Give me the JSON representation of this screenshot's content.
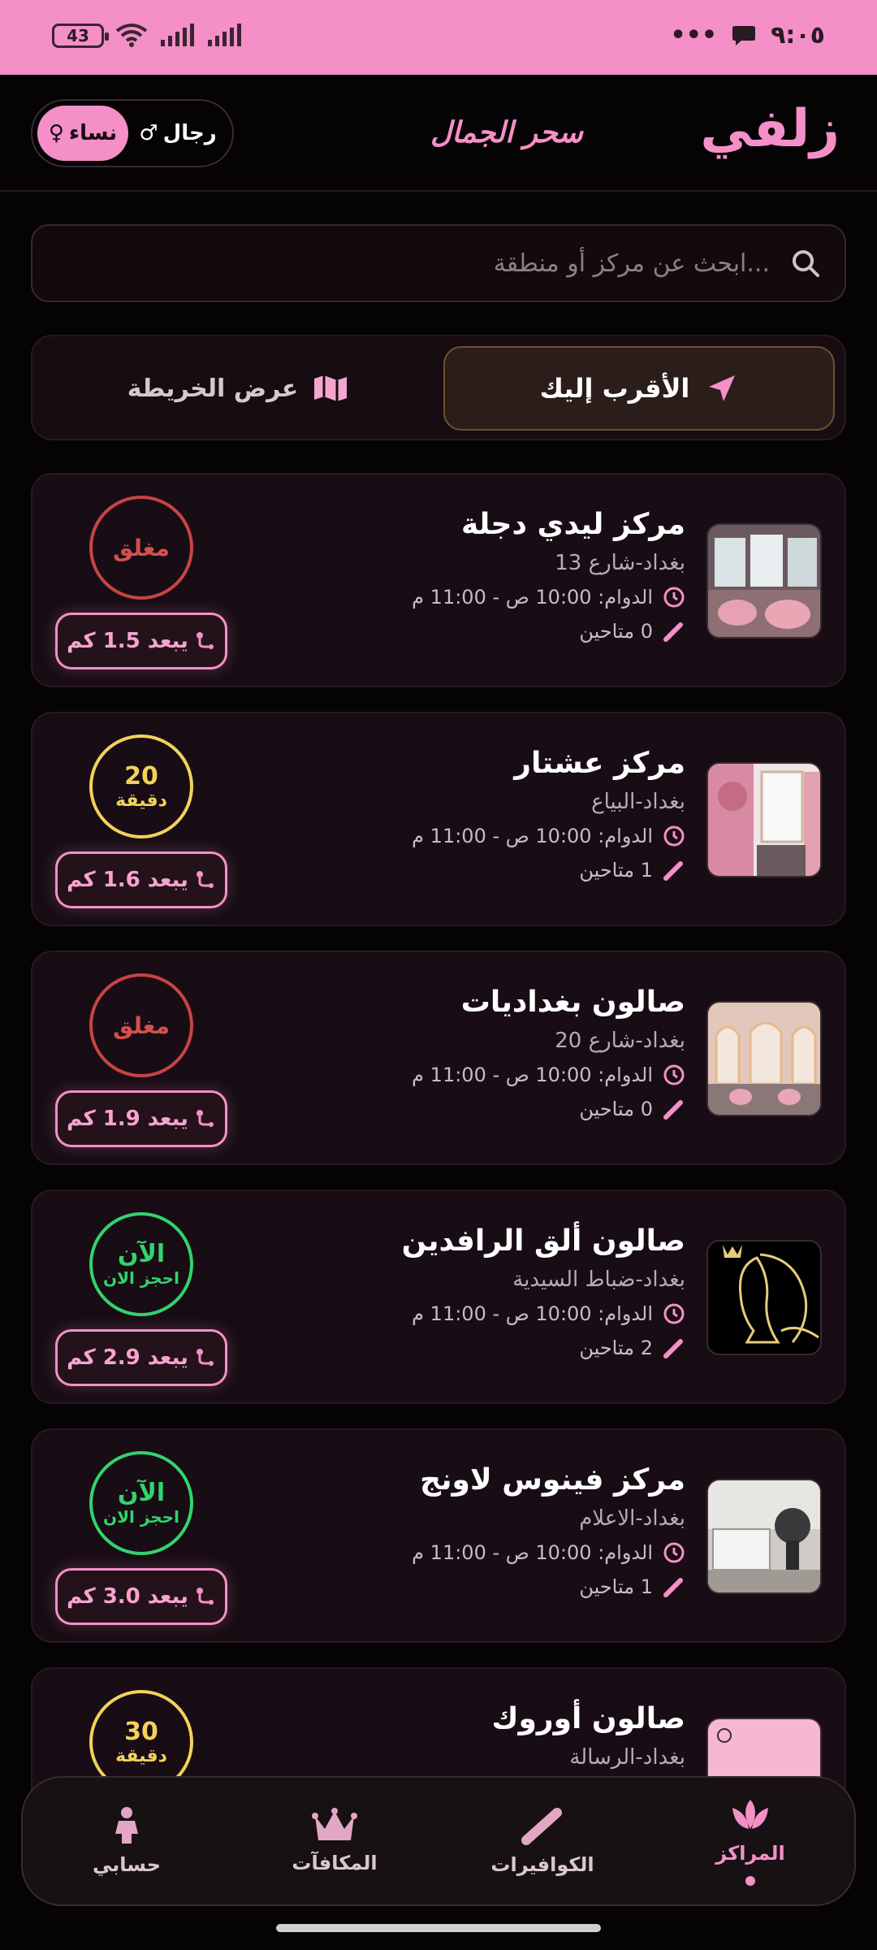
{
  "status_bar": {
    "battery": "43",
    "time": "٩:٠٥",
    "more": "•••"
  },
  "header": {
    "app_title": "زلفي",
    "logo_text": "سحر الجمال",
    "gender_women": "نساء",
    "gender_men": "رجال"
  },
  "search": {
    "placeholder": "ابحث عن مركز أو منطقة..."
  },
  "toggle": {
    "nearest": "الأقرب إليك",
    "map": "عرض الخريطة"
  },
  "centers": [
    {
      "name": "مركز ليدي دجلة",
      "area": "بغداد-شارع 13",
      "hours": "الدوام: 10:00 ص - 11:00 م",
      "stylists": "0 متاحين",
      "status": "closed",
      "status_main": "مغلق",
      "status_sub": "",
      "distance": "يبعد 1.5 كم"
    },
    {
      "name": "مركز عشتار",
      "area": "بغداد-البياع",
      "hours": "الدوام: 10:00 ص - 11:00 م",
      "stylists": "1 متاحين",
      "status": "wait",
      "status_main": "20",
      "status_sub": "دقيقة",
      "distance": "يبعد 1.6 كم"
    },
    {
      "name": "صالون بغداديات",
      "area": "بغداد-شارع 20",
      "hours": "الدوام: 10:00 ص - 11:00 م",
      "stylists": "0 متاحين",
      "status": "closed",
      "status_main": "مغلق",
      "status_sub": "",
      "distance": "يبعد 1.9 كم"
    },
    {
      "name": "صالون ألق الرافدين",
      "area": "بغداد-ضباط السيدية",
      "hours": "الدوام: 10:00 ص - 11:00 م",
      "stylists": "2 متاحين",
      "status": "open",
      "status_main": "الآن",
      "status_sub": "احجز الان",
      "distance": "يبعد 2.9 كم"
    },
    {
      "name": "مركز فينوس لاونج",
      "area": "بغداد-الاعلام",
      "hours": "الدوام: 10:00 ص - 11:00 م",
      "stylists": "1 متاحين",
      "status": "open",
      "status_main": "الآن",
      "status_sub": "احجز الان",
      "distance": "يبعد 3.0 كم"
    },
    {
      "name": "صالون أوروك",
      "area": "بغداد-الرسالة",
      "hours": "",
      "stylists": "",
      "status": "wait",
      "status_main": "30",
      "status_sub": "دقيقة",
      "distance": ""
    }
  ],
  "bottom_nav": {
    "centers": "المراكز",
    "stylists": "الكوافيرات",
    "rewards": "المكافآت",
    "account": "حسابي"
  },
  "colors": {
    "accent": "#f58fc8",
    "closed": "#c84444",
    "wait": "#f2d25a",
    "open": "#33d36e"
  }
}
